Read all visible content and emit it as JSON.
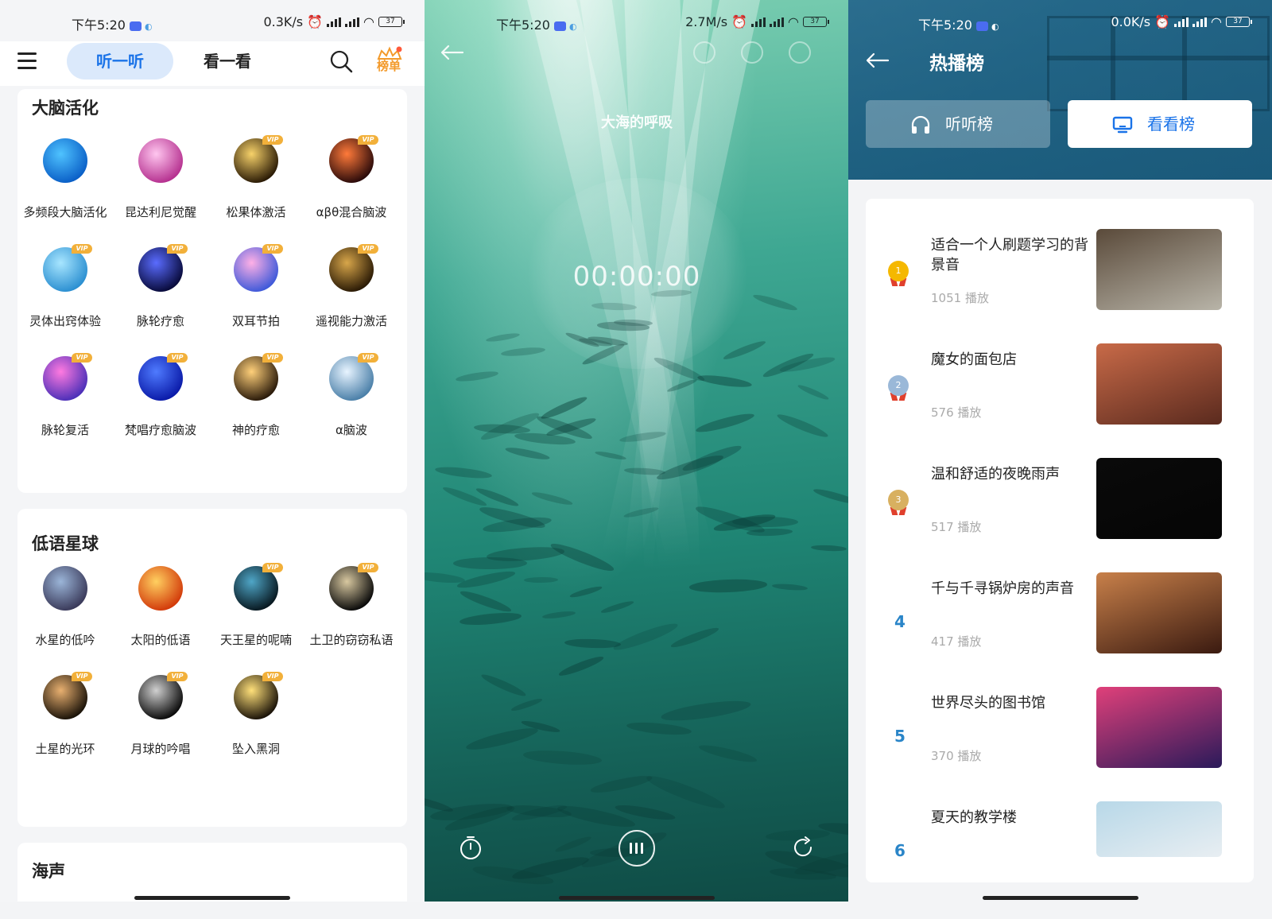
{
  "status": {
    "time": "下午5:20",
    "s1_speed": "0.3K/s",
    "s2_speed": "2.7M/s",
    "s3_speed": "0.0K/s",
    "battery": "37"
  },
  "home": {
    "tab_listen": "听一听",
    "tab_watch": "看一看",
    "rank_label": "榜单",
    "sections": [
      {
        "title": "大脑活化",
        "items": [
          {
            "label": "多频段大脑活化",
            "vip": false,
            "color1": "#4fc3ff",
            "color2": "#0a5fc7"
          },
          {
            "label": "昆达利尼觉醒",
            "vip": false,
            "color1": "#ffc6ef",
            "color2": "#b5308f"
          },
          {
            "label": "松果体激活",
            "vip": true,
            "color1": "#f7d26a",
            "color2": "#2a1a05"
          },
          {
            "label": "αβθ混合脑波",
            "vip": true,
            "color1": "#ff7a3a",
            "color2": "#2a0a0a"
          },
          {
            "label": "灵体出窍体验",
            "vip": true,
            "color1": "#a8e6ff",
            "color2": "#2b8fd1"
          },
          {
            "label": "脉轮疗愈",
            "vip": true,
            "color1": "#5a6cff",
            "color2": "#080a3a"
          },
          {
            "label": "双耳节拍",
            "vip": true,
            "color1": "#ffb0e6",
            "color2": "#3e59d9"
          },
          {
            "label": "遥视能力激活",
            "vip": true,
            "color1": "#d8a64a",
            "color2": "#2a1a05"
          },
          {
            "label": "脉轮复活",
            "vip": true,
            "color1": "#ff7ae0",
            "color2": "#4b2fb8"
          },
          {
            "label": "梵唱疗愈脑波",
            "vip": true,
            "color1": "#4f7bff",
            "color2": "#0a1aa8"
          },
          {
            "label": "神的疗愈",
            "vip": true,
            "color1": "#ffd07a",
            "color2": "#2a1a0a"
          },
          {
            "label": "α脑波",
            "vip": true,
            "color1": "#e8f4ff",
            "color2": "#4a7fa8"
          }
        ]
      },
      {
        "title": "低语星球",
        "items": [
          {
            "label": "水星的低吟",
            "vip": false,
            "color1": "#9bb5d8",
            "color2": "#3a3a5a"
          },
          {
            "label": "太阳的低语",
            "vip": false,
            "color1": "#ffd060",
            "color2": "#d23a0a"
          },
          {
            "label": "天王星的呢喃",
            "vip": true,
            "color1": "#4fa6c7",
            "color2": "#081820"
          },
          {
            "label": "土卫的窃窃私语",
            "vip": true,
            "color1": "#d8c8a0",
            "color2": "#0a0a0a"
          },
          {
            "label": "土星的光环",
            "vip": true,
            "color1": "#e8b070",
            "color2": "#1a1208"
          },
          {
            "label": "月球的吟唱",
            "vip": true,
            "color1": "#d0d0d0",
            "color2": "#0a0a0a"
          },
          {
            "label": "坠入黑洞",
            "vip": true,
            "color1": "#ffe07a",
            "color2": "#1a1208"
          }
        ]
      },
      {
        "title": "海声"
      }
    ]
  },
  "player": {
    "title": "大海的呼吸",
    "timer": "00:00:00"
  },
  "chart": {
    "title": "热播榜",
    "tab_listen": "听听榜",
    "tab_watch": "看看榜",
    "rows": [
      {
        "rank": "1",
        "title": "适合一个人刷题学习的背景音",
        "plays": "1051 播放",
        "medal_color": "#f5b800",
        "thumb1": "#5a4a3a",
        "thumb2": "#b8b4a8"
      },
      {
        "rank": "2",
        "title": "魔女的面包店",
        "plays": "576 播放",
        "medal_color": "#9ab8d8",
        "thumb1": "#c86a48",
        "thumb2": "#5a2a1e"
      },
      {
        "rank": "3",
        "title": "温和舒适的夜晚雨声",
        "plays": "517 播放",
        "medal_color": "#d8b060",
        "thumb1": "#0a0a0a",
        "thumb2": "#050505"
      },
      {
        "rank": "4",
        "title": "千与千寻锅炉房的声音",
        "plays": "417 播放",
        "medal_color": "",
        "thumb1": "#c8804a",
        "thumb2": "#3a1a10"
      },
      {
        "rank": "5",
        "title": "世界尽头的图书馆",
        "plays": "370 播放",
        "medal_color": "",
        "thumb1": "#e0407a",
        "thumb2": "#2a1a5a"
      },
      {
        "rank": "6",
        "title": "夏天的教学楼",
        "plays": "",
        "medal_color": "",
        "thumb1": "#b8d8e8",
        "thumb2": "#e8eef2"
      }
    ]
  }
}
